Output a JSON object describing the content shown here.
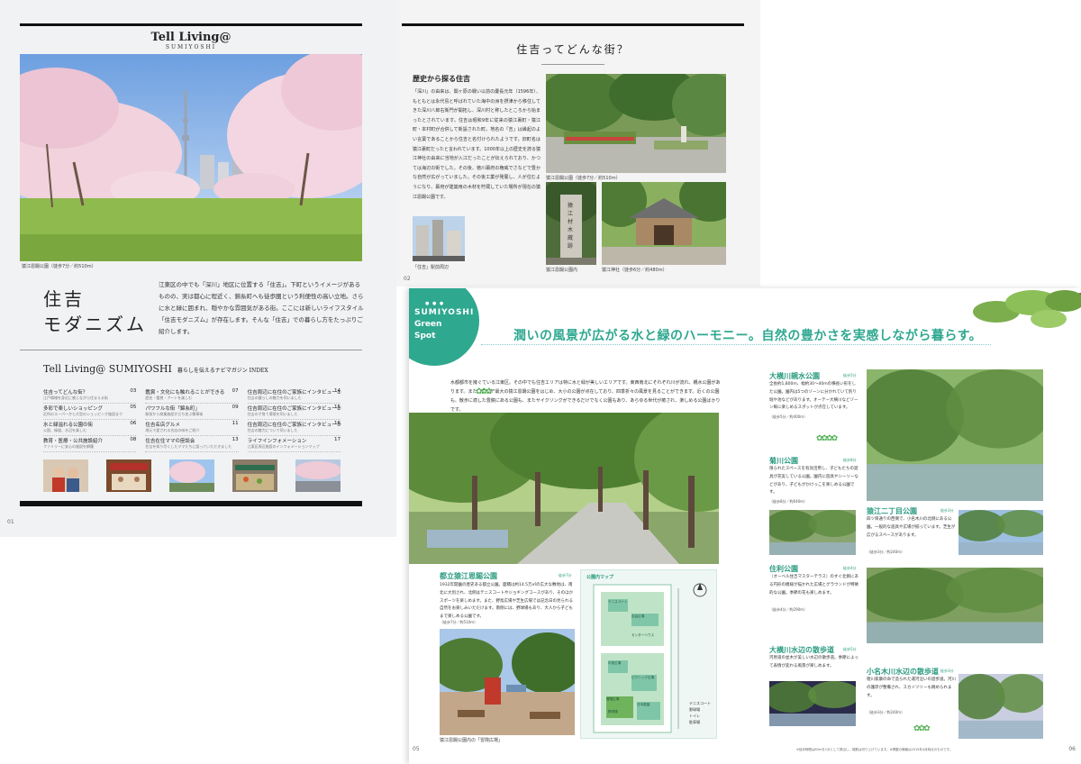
{
  "page01": {
    "mast_title": "Tell Living@",
    "mast_sub": "SUMIYOSHI",
    "hero_caption": "猿江恩賜公園（徒歩7分／約510m）",
    "title_l1": "住吉",
    "title_l2": "モダニズム",
    "lead": "江東区の中でも「深川」地区に位置する「住吉」。下町というイメージがあるものの、実は都心に程近く、錦糸町へも徒歩圏という利便性の高い立地。さらに水と緑に囲まれ、穏やかな雰囲気がある街。ここには新しいライフスタイル「住吉モダニズム」が存在します。そんな「住吉」での暮らし方をたっぷりご紹介します。",
    "index_title": "Tell Living@ SUMIYOSHI",
    "index_sub": "暮らしを伝えるナビマガジン INDEX",
    "index": [
      {
        "name": "住吉ってどんな街？",
        "desc": "江戸情緒を身近に感じながら住まえる街",
        "page": "03"
      },
      {
        "name": "鑑賞・文化にも触れることができる",
        "desc": "歴史・鑑賞・アートを楽しむ",
        "page": "07"
      },
      {
        "name": "住吉周辺に在住のご家族にインタビュー①",
        "desc": "住吉の暮らしの魅力を伺いました",
        "page": "14"
      },
      {
        "name": "多彩で楽しいショッピング",
        "desc": "近所のスーパーから大型のショッピング施設まで",
        "page": "05"
      },
      {
        "name": "パワフルな街「錦糸町」",
        "desc": "駅前から商業施設が立ち並ぶ繁華街",
        "page": "09"
      },
      {
        "name": "住吉周辺に在住のご家族にインタビュー②",
        "desc": "住吉の子育て環境を伺いました",
        "page": "15"
      },
      {
        "name": "水と緑溢れる公園の街",
        "desc": "公園、緑道、水辺を楽しむ",
        "page": "06"
      },
      {
        "name": "住吉名店グルメ",
        "desc": "地元で愛される名店の味をご紹介",
        "page": "11"
      },
      {
        "name": "住吉周辺に在住のご家族にインタビュー③",
        "desc": "住吉の魅力について伺いました",
        "page": "16"
      },
      {
        "name": "教育・医療・公共施設紹介",
        "desc": "ファミリーに安心の施設を網羅",
        "page": "08"
      },
      {
        "name": "住吉在住ママの座談会",
        "desc": "住吉を知り尽くしたママたちに語っていただきました",
        "page": "13"
      },
      {
        "name": "ライフインフォメーション",
        "desc": "江東区周辺施設のインフォメーションマップ",
        "page": "17"
      }
    ],
    "page_number": "01"
  },
  "page02": {
    "heading": "住吉ってどんな街？",
    "subheading": "歴史から探る住吉",
    "body": "「深川」の由来は、関ヶ原の戦い以前の慶長元年（1596年）、もともとは永代島と呼ばれていた海中の洲を摂津から移住してきた深川八郎右衛門が開拓し、深川村と称したところから始まったとされています。住吉は昭和9年に従来の猿江裏町・猿江町・本村町が合併して新設された町。地名の「吉」は縁起のよい言葉であることから住吉と名付けられたようです。旧町名は猿江裏町だったと言われています。1000年以上の歴史を誇る猿江神社の由来に当地が入江だったことが伝えられており、かつては海辺の街でした。その後、徳川幕府の権威でさなどで豊かな自然が広がっていました。その後工業が発展し、人が住むようになり、幕府が建築用の木材を貯蔵していた場所が現在の猿江恩賜公園です。",
    "cap_main": "猿江恩賜公園（徒歩7分／約510m）",
    "cap_street": "「住吉」駅前周辺",
    "cap_stone": "猿江恩賜公園内",
    "cap_shrine": "猿江神社（徒歩6分／約480m）",
    "stone_text": "猿江材木蔵跡",
    "page_number": "02"
  },
  "page03": {
    "badge_dots": "● ● ●",
    "badge_l1": "SUMIYOSHI",
    "badge_l2": "Green",
    "badge_l3": "Spot",
    "headline": "潤いの風景が広がる水と緑のハーモニー。自然の豊かさを実感しながら暮らす。",
    "intro": "水都都市を擁ぐている江東区。その中でも住吉エリアは特に水と緑が美しいエリアです。東西南北にそれぞれ川が流れ、親水公園があります。また、エリア最大の猿江恩賜公園をはじめ、大小の公園が点在しており、四季折々の風景を見ることができます。近くの公園も、散歩に適した豊饒にある公園も、またサイクリングができるだけでなく公園もあり、あらゆる世代が癒され、楽しめる公園ばかりです。",
    "main_park": {
      "title": "都立猿江恩賜公園",
      "tag": "徒歩7分",
      "desc": "1932年開園の歴史ある都立公園。面積は約14.5万㎡の広大な敷地は、南北に大別され、北側はテニスコートやジョギングコースがあり、そのほかスポーツを楽しめます。また、野鳥広場や芝生広場では記念日の見られる自然をお楽しみいただけます。南側には、野球場もあり、大人から子どもまで楽しめる公園です。",
      "sub": "（徒歩7分／約510m）",
      "cap": "猿江恩賜公園内の「冒険広場」"
    },
    "map_label": "公園内マップ",
    "map_legend": [
      "テニスコート",
      "野球場",
      "トイレ",
      "駐車場"
    ],
    "map_labels": [
      "テニスコート",
      "自由広場",
      "中央広場",
      "ピクニック広場",
      "センターハウス",
      "冒険広場",
      "野球場",
      "日本庭園"
    ],
    "parks": [
      {
        "title": "大横川親水公園",
        "tag": "徒歩5分",
        "desc": "全長約1,800m、幅約30〜40mの横長い形をした公園。園内は5つのゾーンに分かれていて釣り堀や池などがあります。オーテー大横川などゾーン毎に楽しめるスポットが点在しています。",
        "sub": "（徒歩5分／約400m）"
      },
      {
        "title": "菊川公園",
        "tag": "徒歩8分",
        "desc": "限られたスペースを有効活用し、子どもたちの遊具が充実している公園。園内に遊具やシーソーなどがあり、子どもがかけっこを楽しめる公園です。",
        "sub": "（徒歩8分／約640m）"
      },
      {
        "title": "猿江二丁目公園",
        "tag": "徒歩3分",
        "desc": "四ツ目通りの西側で、小名木川の北側にある公園。一般的な遊具や広場が揃っています。芝生が広がるスペースがあります。",
        "sub": "（徒歩3分／約240m）"
      },
      {
        "title": "住利公園",
        "tag": "徒歩4分",
        "desc": "（オーベル住吉マスターテラス）のすぐ北側にある円形の模様が描かれた広場とグラウンドが特徴的な公園。季節の花も楽しめます。",
        "sub": "（徒歩4分／約290m）"
      },
      {
        "title": "大横川水辺の散歩道",
        "tag": "徒歩5分",
        "desc": "河原道の並木が美しい水辺の散歩道。季節によって表情が変わる風景が楽しめます。",
        "sub": "（徒歩5分／約400m）"
      },
      {
        "title": "小名木川水辺の散歩道",
        "tag": "徒歩3分",
        "desc": "徳川家康の命で造られた運河沿いの遊歩道。河川の護岸が整備され、スカイツリーも眺められます。",
        "sub": "（徒歩3分／約240m）"
      }
    ],
    "page_left": "05",
    "page_right": "06",
    "footnote": "※徒歩時間は80mを1分として算出し、端数は切り上げています。※掲載の情報は2015年4月時点のものです。"
  }
}
